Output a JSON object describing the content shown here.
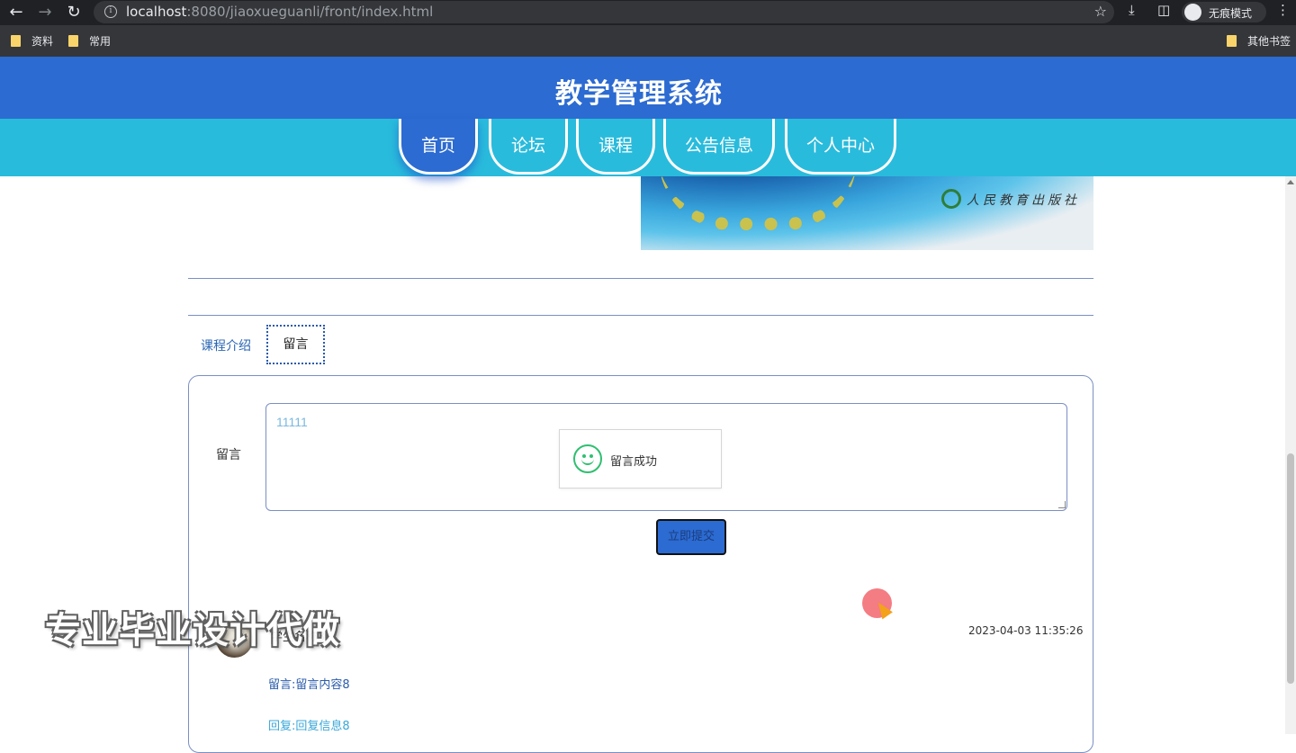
{
  "browser": {
    "url_host": "localhost",
    "url_rest": ":8080/jiaoxueguanli/front/index.html",
    "incognito_label": "无痕模式",
    "bookmarks": [
      "资料",
      "常用"
    ],
    "other_bookmarks": "其他书签"
  },
  "site": {
    "title": "教学管理系统",
    "nav": [
      "首页",
      "论坛",
      "课程",
      "公告信息",
      "个人中心"
    ],
    "active_nav": "首页"
  },
  "banner": {
    "publisher_text": "人民教育出版社"
  },
  "tabs": {
    "intro": "课程介绍",
    "message": "留言"
  },
  "form": {
    "label": "留言",
    "textarea_value": "11111",
    "submit_label": "立即提交"
  },
  "toast": {
    "text": "留言成功",
    "icon": "smile-icon"
  },
  "comment": {
    "user": "学生名称3",
    "time": "2023-04-03 11:35:26",
    "message": "留言:留言内容8",
    "reply": "回复:回复信息8"
  },
  "watermark": "专业毕业设计代做",
  "colors": {
    "header_blue": "#2c6bd1",
    "nav_cyan": "#29bbdc",
    "success_green": "#2fbf71"
  }
}
